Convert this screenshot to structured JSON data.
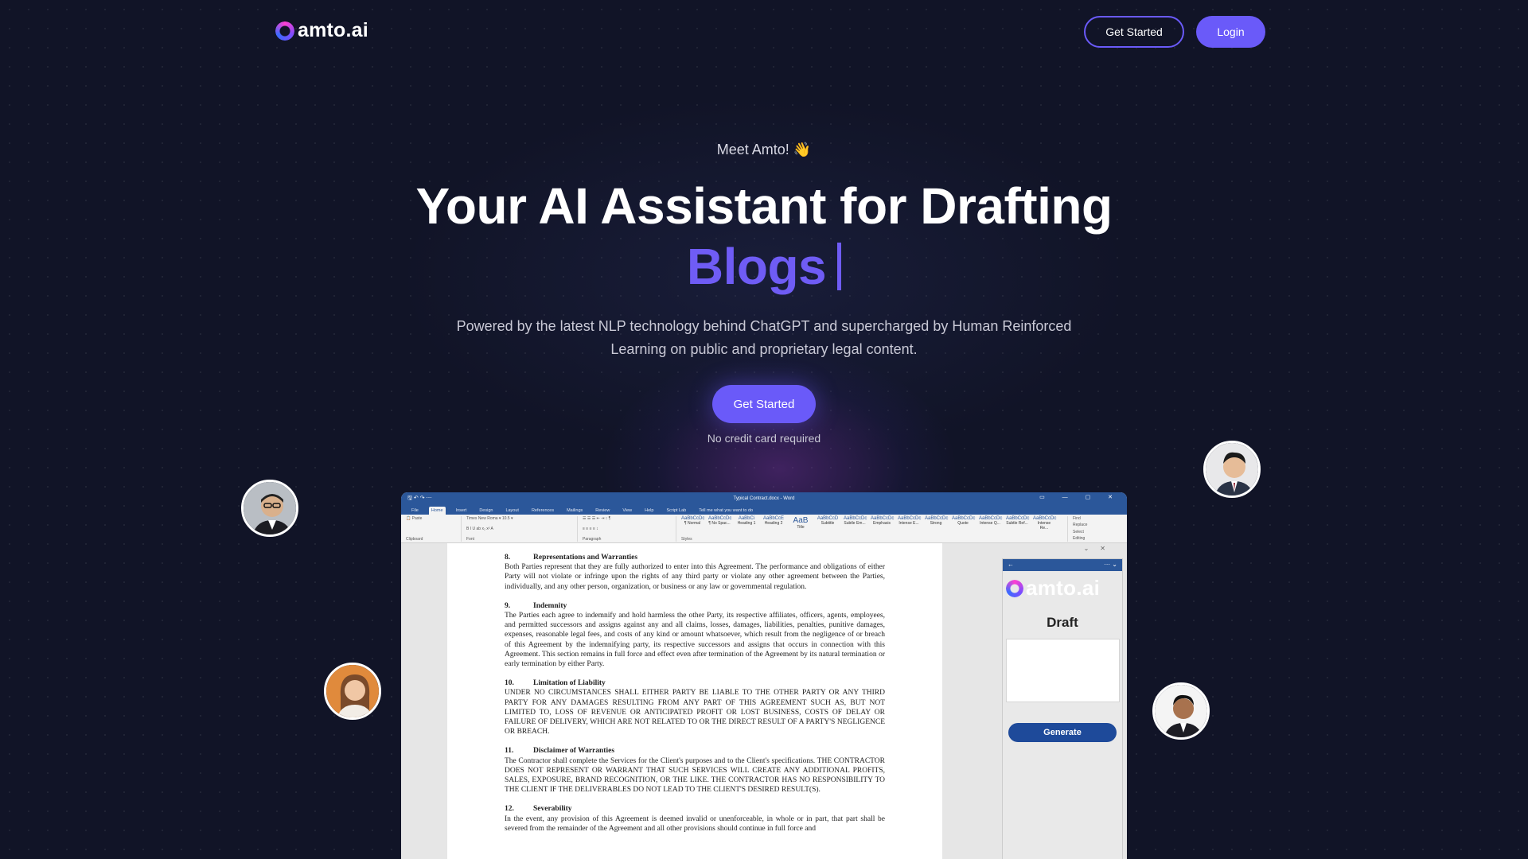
{
  "nav": {
    "logo_text": "amto.ai",
    "get_started": "Get Started",
    "login": "Login"
  },
  "hero": {
    "eyebrow": "Meet Amto! 👋",
    "title_line1": "Your AI Assistant for Drafting",
    "title_line2": "Blogs",
    "subtitle": "Powered by the latest NLP technology behind ChatGPT and supercharged by Human Reinforced Learning on public and proprietary legal content.",
    "cta": "Get Started",
    "note": "No credit card required"
  },
  "colors": {
    "background": "#111427",
    "accent": "#6a5af9",
    "word_blue": "#2b579a"
  },
  "word": {
    "window_title": "Typical Contract.docx  -  Word",
    "quick_access": "🖫 ↶ ↷ ⋯",
    "window_controls": "▭ — ▢ ✕",
    "tabs": [
      "File",
      "Home",
      "Insert",
      "Design",
      "Layout",
      "References",
      "Mailings",
      "Review",
      "View",
      "Help",
      "Script Lab",
      "Tell me what you want to do"
    ],
    "ribbon_groups": [
      "Clipboard",
      "Font",
      "Paragraph",
      "Styles",
      "Editing"
    ],
    "font_name": "Times New Roma",
    "font_size": "10.5",
    "styles": [
      {
        "sample": "AaBbCcDc",
        "name": "¶ Normal"
      },
      {
        "sample": "AaBbCcDc",
        "name": "¶ No Spac..."
      },
      {
        "sample": "AaBbCi",
        "name": "Heading 1"
      },
      {
        "sample": "AaBbCcE",
        "name": "Heading 2"
      },
      {
        "sample": "AaB",
        "name": "Title"
      },
      {
        "sample": "AaBbCcD",
        "name": "Subtitle"
      },
      {
        "sample": "AaBbCcDc",
        "name": "Subtle Em..."
      },
      {
        "sample": "AaBbCcDc",
        "name": "Emphasis"
      },
      {
        "sample": "AaBbCcDc",
        "name": "Intense E..."
      },
      {
        "sample": "AaBbCcDc",
        "name": "Strong"
      },
      {
        "sample": "AaBbCcDc",
        "name": "Quote"
      },
      {
        "sample": "AaBbCcDc",
        "name": "Intense Q..."
      },
      {
        "sample": "AaBbCcDc",
        "name": "Subtle Ref..."
      },
      {
        "sample": "AaBbCcDc",
        "name": "Intense Re..."
      }
    ],
    "editing": [
      "Find",
      "Replace",
      "Select"
    ],
    "sections": [
      {
        "num": "8.",
        "title": "Representations and Warranties",
        "text": "Both Parties represent that they are fully authorized to enter into this Agreement. The performance and obligations of either Party will not violate or infringe upon the rights of any third party or violate any other agreement between the Parties, individually, and any other person, organization, or business or any law or governmental regulation."
      },
      {
        "num": "9.",
        "title": "Indemnity",
        "text": "The Parties each agree to indemnify and hold harmless the other Party, its respective affiliates, officers, agents, employees, and permitted successors and assigns against any and all claims, losses, damages, liabilities, penalties, punitive damages, expenses, reasonable legal fees, and costs of any kind or amount whatsoever, which result from the negligence of or breach of this Agreement by the indemnifying party, its respective successors and assigns that occurs in connection with this Agreement. This section remains in full force and effect even after termination of the Agreement by its natural termination or early termination by either Party."
      },
      {
        "num": "10.",
        "title": "Limitation of Liability",
        "text": "UNDER NO CIRCUMSTANCES SHALL EITHER PARTY BE LIABLE TO THE OTHER PARTY OR ANY THIRD PARTY FOR ANY DAMAGES RESULTING FROM ANY PART OF THIS AGREEMENT SUCH AS, BUT NOT LIMITED TO, LOSS OF REVENUE OR ANTICIPATED PROFIT OR LOST BUSINESS, COSTS OF DELAY OR FAILURE OF DELIVERY, WHICH ARE NOT RELATED TO OR THE DIRECT RESULT OF A PARTY'S NEGLIGENCE OR BREACH."
      },
      {
        "num": "11.",
        "title": "Disclaimer of Warranties",
        "text": "The Contractor shall complete the Services for the Client's purposes and to the Client's specifications. THE CONTRACTOR DOES NOT REPRESENT OR WARRANT THAT SUCH SERVICES WILL CREATE ANY ADDITIONAL PROFITS, SALES, EXPOSURE, BRAND RECOGNITION, OR THE LIKE. THE CONTRACTOR HAS NO RESPONSIBILITY TO THE CLIENT IF THE DELIVERABLES DO NOT LEAD TO THE CLIENT'S DESIRED RESULT(S)."
      },
      {
        "num": "12.",
        "title": "Severability",
        "text": "In the event, any provision of this Agreement is deemed invalid or unenforceable, in whole or in part, that part shall be severed from the remainder of the Agreement and all other provisions should continue in full force and"
      }
    ],
    "addin": {
      "logo_text": "amto.ai",
      "heading": "Draft",
      "generate": "Generate"
    }
  }
}
